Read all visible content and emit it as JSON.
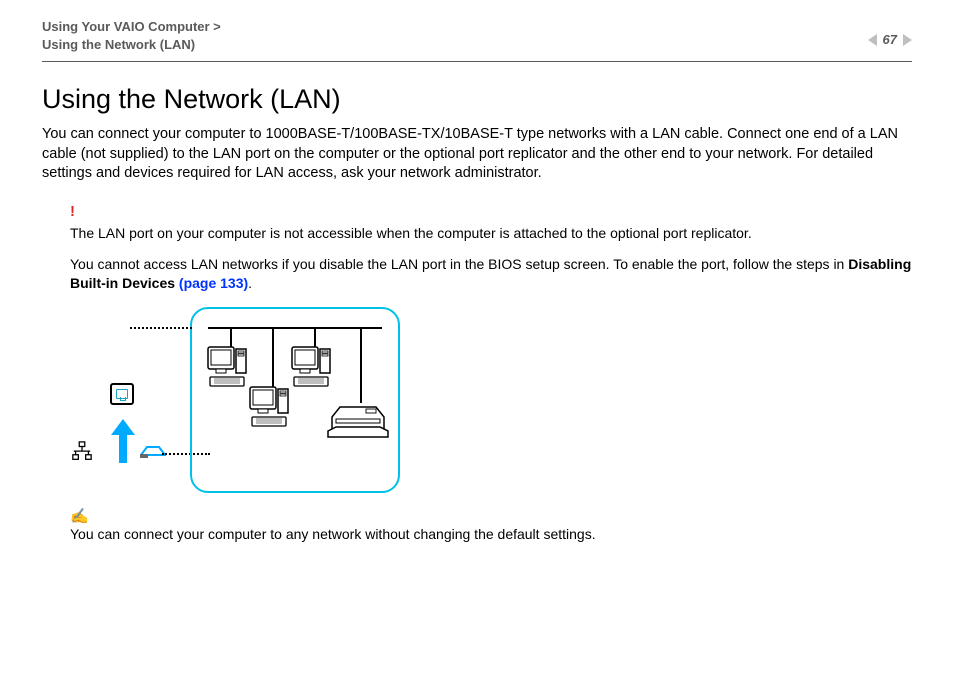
{
  "header": {
    "breadcrumb_line1": "Using Your VAIO Computer >",
    "breadcrumb_line2": "Using the Network (LAN)",
    "page_number": "67"
  },
  "title": "Using the Network (LAN)",
  "intro": "You can connect your computer to 1000BASE-T/100BASE-TX/10BASE-T type networks with a LAN cable. Connect one end of a LAN cable (not supplied) to the LAN port on the computer or the optional port replicator and the other end to your network. For detailed settings and devices required for LAN access, ask your network administrator.",
  "warning_mark": "!",
  "warning_text1": "The LAN port on your computer is not accessible when the computer is attached to the optional port replicator.",
  "warning_text2_a": "You cannot access LAN networks if you disable the LAN port in the BIOS setup screen. To enable the port, follow the steps in ",
  "warning_link_bold": "Disabling Built-in Devices ",
  "warning_link_blue": "(page 133)",
  "warning_text2_c": ".",
  "note_icon": "✍",
  "footnote": "You can connect your computer to any network without changing the default settings."
}
